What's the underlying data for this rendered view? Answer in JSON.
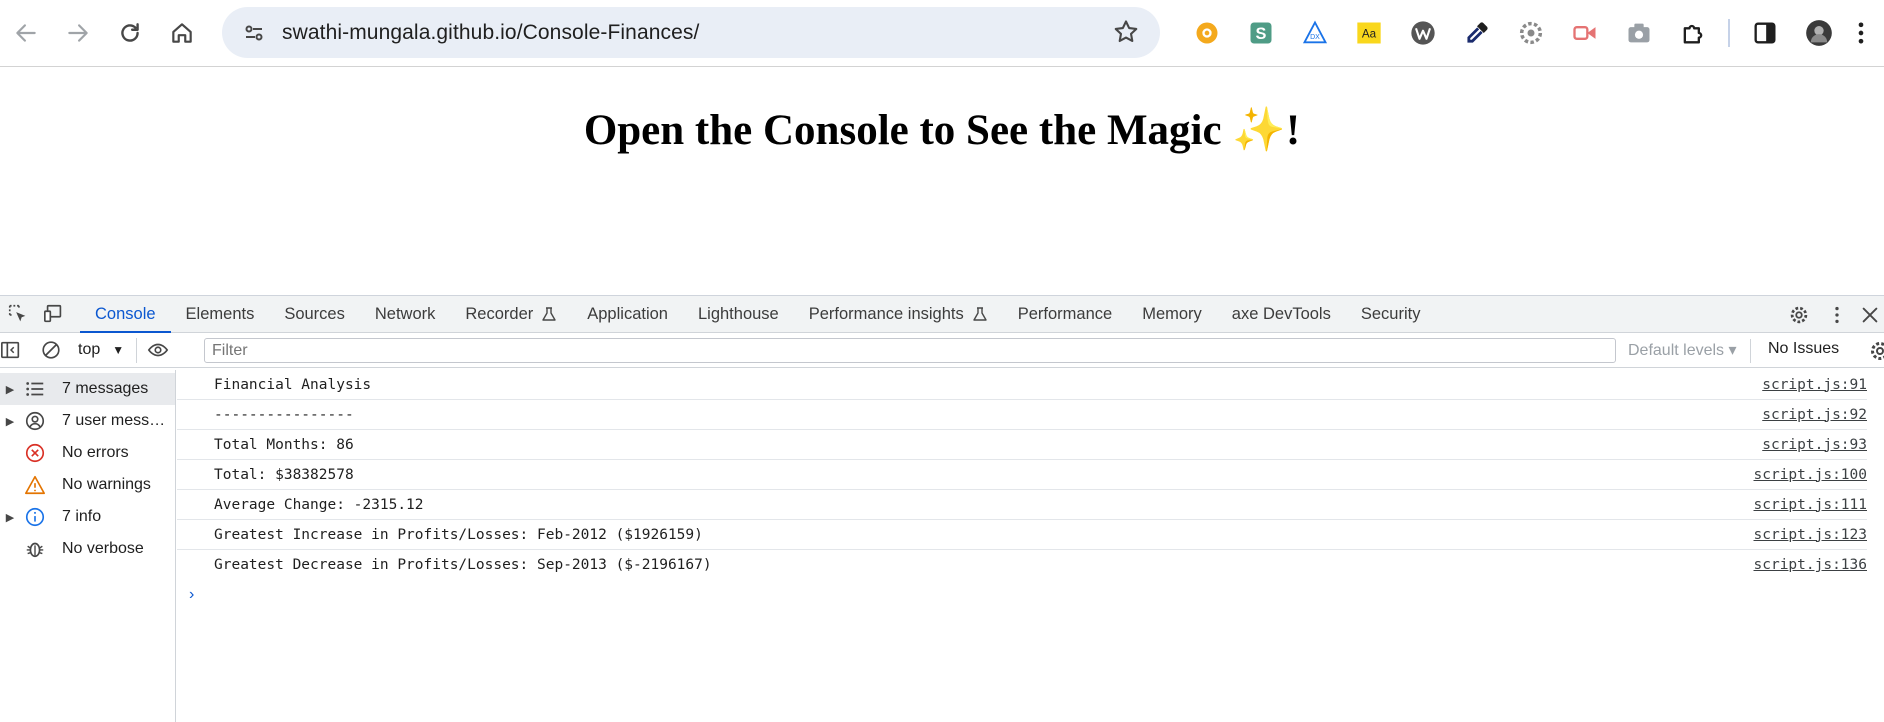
{
  "browser": {
    "url": "swathi-mungala.github.io/Console-Finances/"
  },
  "page": {
    "title": "Open the Console to See the Magic ✨!"
  },
  "devtools": {
    "tabs": [
      {
        "label": "Console",
        "active": true
      },
      {
        "label": "Elements"
      },
      {
        "label": "Sources"
      },
      {
        "label": "Network"
      },
      {
        "label": "Recorder"
      },
      {
        "label": "Application"
      },
      {
        "label": "Lighthouse"
      },
      {
        "label": "Performance insights"
      },
      {
        "label": "Performance"
      },
      {
        "label": "Memory"
      },
      {
        "label": "axe DevTools"
      },
      {
        "label": "Security"
      }
    ],
    "console_bar": {
      "context": "top",
      "filter_placeholder": "Filter",
      "levels": "Default levels ▾",
      "issues": "No Issues"
    },
    "sidebar": [
      {
        "label": "7 messages",
        "icon": "list-icon",
        "expandable": true
      },
      {
        "label": "7 user messages",
        "icon": "user-icon",
        "expandable": true
      },
      {
        "label": "No errors",
        "icon": "error-icon",
        "expandable": false
      },
      {
        "label": "No warnings",
        "icon": "warning-icon",
        "expandable": false
      },
      {
        "label": "7 info",
        "icon": "info-icon",
        "expandable": true
      },
      {
        "label": "No verbose",
        "icon": "bug-icon",
        "expandable": false
      }
    ],
    "log": [
      {
        "message": "Financial Analysis",
        "source": "script.js:91"
      },
      {
        "message": "----------------",
        "source": "script.js:92"
      },
      {
        "message": "Total Months: 86",
        "source": "script.js:93"
      },
      {
        "message": "Total: $38382578",
        "source": "script.js:100"
      },
      {
        "message": "Average Change: -2315.12",
        "source": "script.js:111"
      },
      {
        "message": "Greatest Increase in Profits/Losses: Feb-2012 ($1926159)",
        "source": "script.js:123"
      },
      {
        "message": "Greatest Decrease in Profits/Losses: Sep-2013 ($-2196167)",
        "source": "script.js:136"
      }
    ],
    "prompt_glyph": "›"
  },
  "colors": {
    "accent": "#0b57d0",
    "omnibox_bg": "#e9eef6",
    "devtools_bar_bg": "#f1f3f4",
    "error": "#d93025",
    "warning": "#e37400"
  }
}
